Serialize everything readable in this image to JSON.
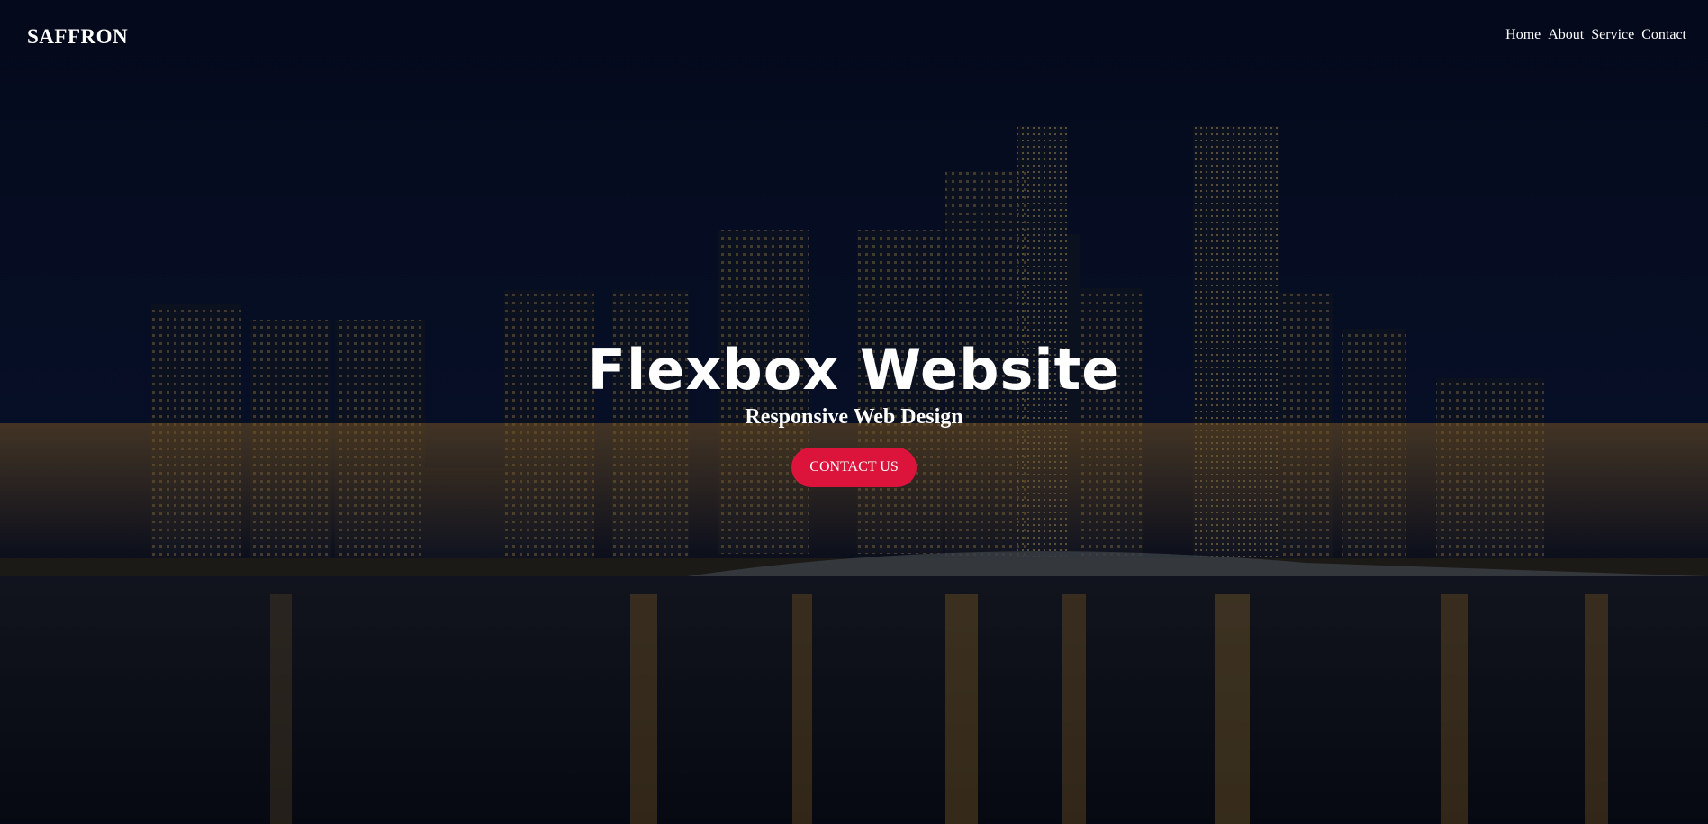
{
  "brand": {
    "name": "SAFFRON"
  },
  "nav": {
    "items": [
      "Home",
      "About",
      "Service",
      "Contact"
    ]
  },
  "hero": {
    "title": "Flexbox Website",
    "subtitle": "Responsive Web Design",
    "cta_label": "CONTACT US"
  },
  "colors": {
    "cta_background": "#dc143c",
    "text": "#ffffff",
    "overlay": "#050a18"
  },
  "icons": {
    "background": "night-city-skyline-image"
  }
}
